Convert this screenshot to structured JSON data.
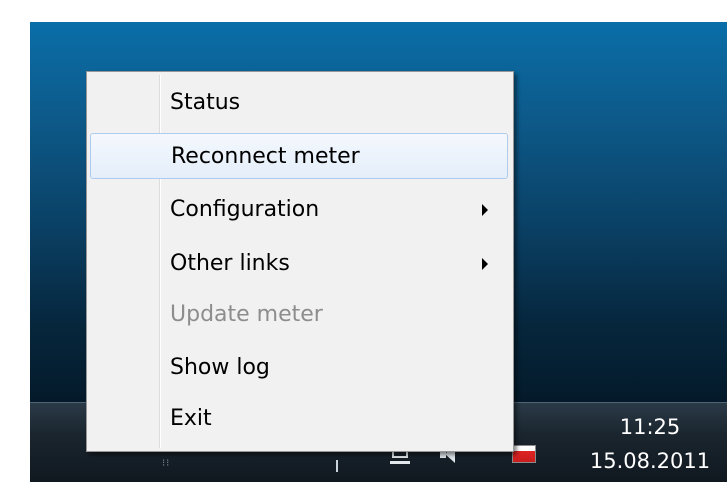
{
  "context_menu": {
    "items": [
      {
        "label": "Status",
        "state": "normal"
      },
      {
        "label": "Reconnect meter",
        "state": "hover"
      },
      {
        "label": "Configuration",
        "state": "normal",
        "submenu": true
      },
      {
        "label": "Other links",
        "state": "normal",
        "submenu": true
      },
      {
        "label": "Update meter",
        "state": "disabled"
      },
      {
        "label": "Show log",
        "state": "normal"
      },
      {
        "label": "Exit",
        "state": "normal"
      }
    ]
  },
  "taskbar": {
    "tray_icons": [
      "network-icon",
      "speaker-icon",
      "meter-icon"
    ],
    "clock_time": "11:25",
    "clock_date": "15.08.2011"
  },
  "colors": {
    "desktop_top": "#0a6ea8",
    "desktop_bottom": "#041a2a",
    "menu_background": "#f1f1f1",
    "hover_border": "#aecbee",
    "disabled_text": "#8d8d8d"
  }
}
